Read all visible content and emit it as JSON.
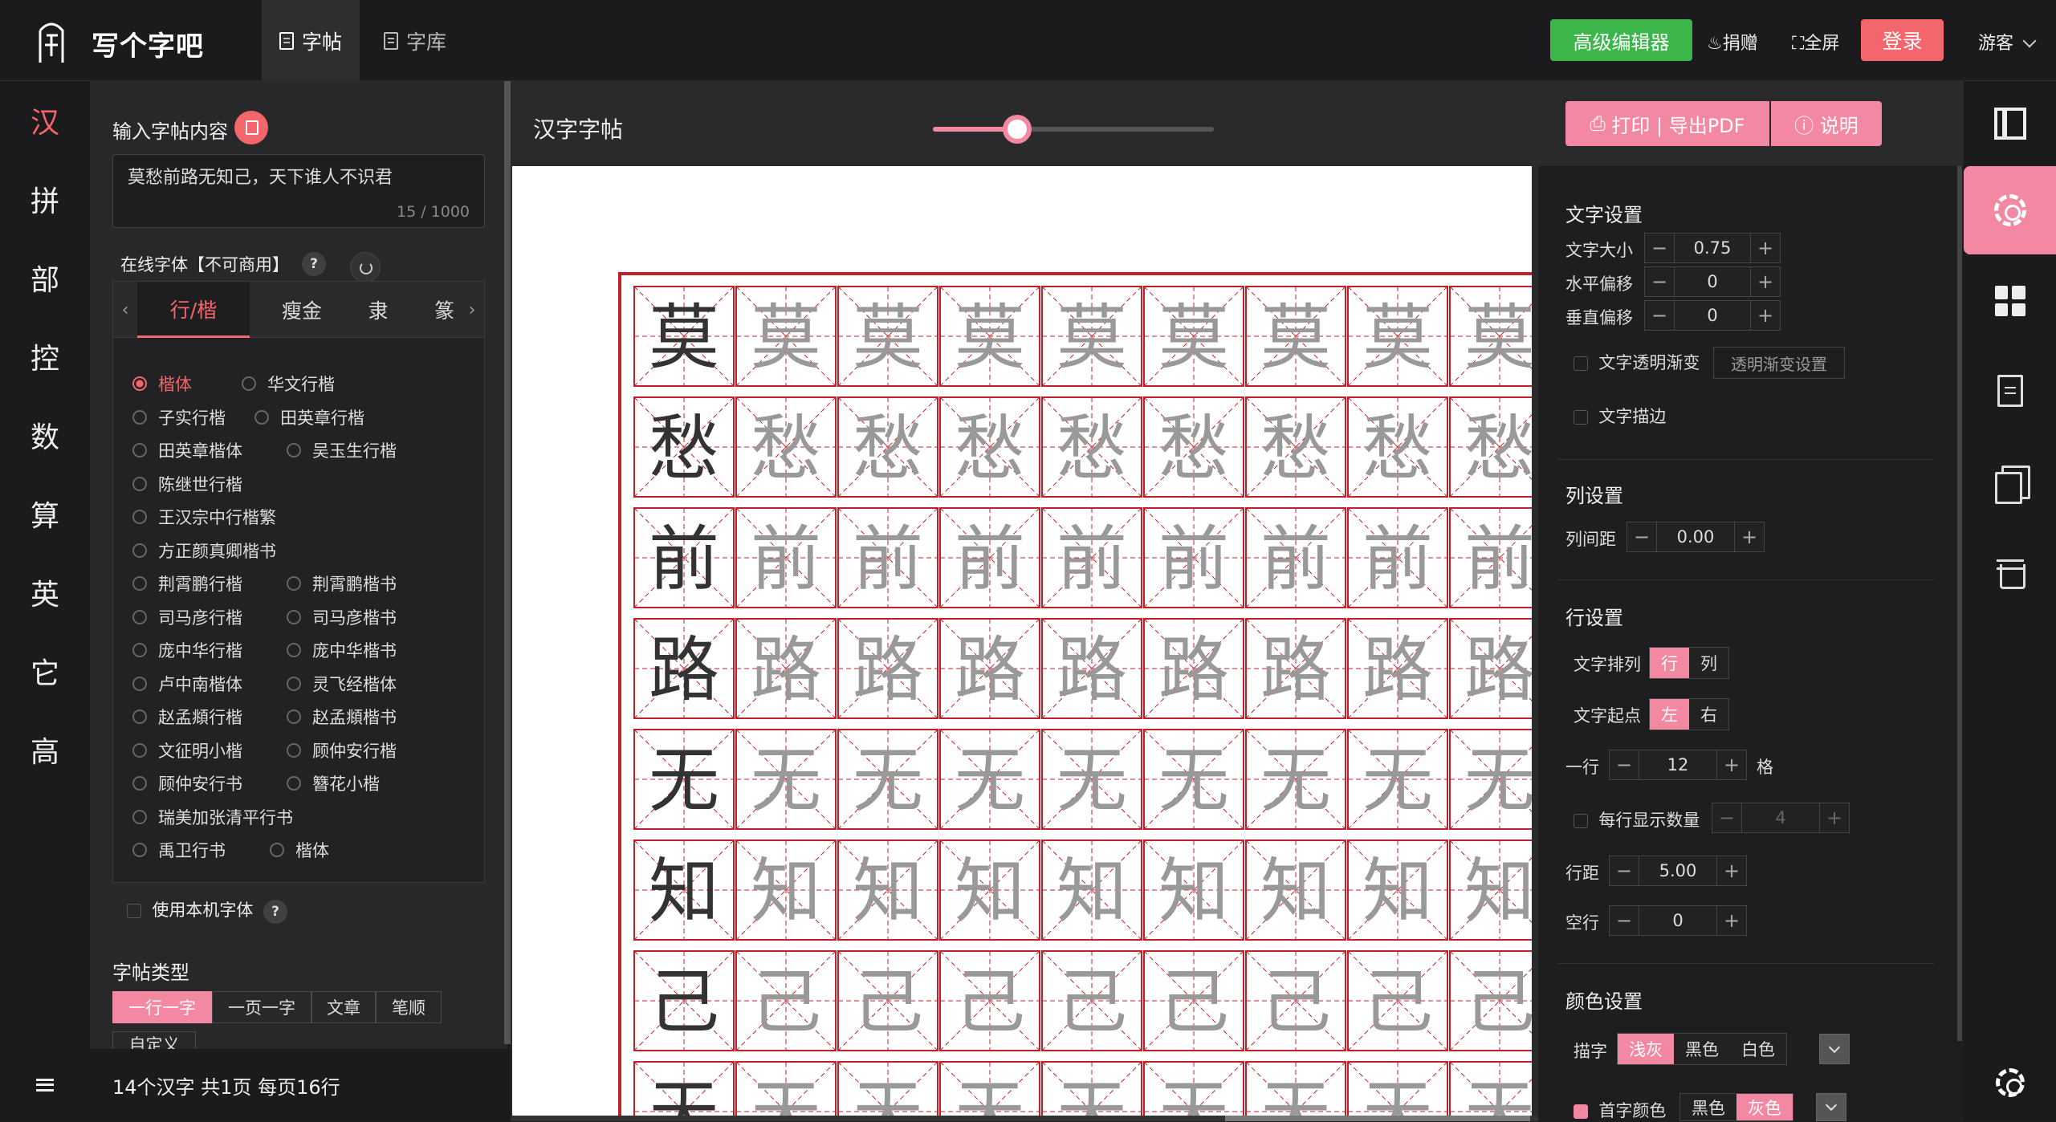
{
  "app": {
    "name": "写个字吧"
  },
  "nav": {
    "tabs": [
      {
        "label": "字帖",
        "active": true
      },
      {
        "label": "字库",
        "active": false
      }
    ]
  },
  "header": {
    "advanced_editor": "高级编辑器",
    "donate": "捐赠",
    "fullscreen": "全屏",
    "login": "登录",
    "guest": "游客"
  },
  "categories": [
    "汉",
    "拼",
    "部",
    "控",
    "数",
    "算",
    "英",
    "它",
    "高"
  ],
  "left_panel": {
    "input_label": "输入字帖内容",
    "content": "莫愁前路无知己，天下谁人不识君",
    "char_count": "15 / 1000",
    "online_font_label": "在线字体【不可商用】",
    "font_tabs": [
      "行/楷",
      "瘦金",
      "隶",
      "篆"
    ],
    "fonts": [
      {
        "name": "楷体",
        "selected": true
      },
      {
        "name": "华文行楷"
      },
      {
        "name": "子实行楷"
      },
      {
        "name": "田英章行楷"
      },
      {
        "name": "田英章楷体"
      },
      {
        "name": "吴玉生行楷"
      },
      {
        "name": "陈继世行楷"
      },
      {
        "name": "王汉宗中行楷繁"
      },
      {
        "name": "方正颜真卿楷书"
      },
      {
        "name": "荆霄鹏行楷"
      },
      {
        "name": "荆霄鹏楷书"
      },
      {
        "name": "司马彦行楷"
      },
      {
        "name": "司马彦楷书"
      },
      {
        "name": "庞中华行楷"
      },
      {
        "name": "庞中华楷书"
      },
      {
        "name": "卢中南楷体"
      },
      {
        "name": "灵飞经楷体"
      },
      {
        "name": "赵孟頫行楷"
      },
      {
        "name": "赵孟頫楷书"
      },
      {
        "name": "文征明小楷"
      },
      {
        "name": "顾仲安行楷"
      },
      {
        "name": "顾仲安行书"
      },
      {
        "name": "簪花小楷"
      },
      {
        "name": "瑞美加张清平行书"
      },
      {
        "name": "禹卫行书"
      },
      {
        "name": "楷体"
      }
    ],
    "use_local_font": "使用本机字体",
    "type_label": "字帖类型",
    "types": [
      {
        "label": "一行一字",
        "active": true
      },
      {
        "label": "一页一字"
      },
      {
        "label": "文章"
      },
      {
        "label": "笔顺"
      },
      {
        "label": "自定义"
      }
    ]
  },
  "status": "14个汉字 共1页 每页16行",
  "preview": {
    "title": "汉字字帖",
    "zoom": 0.3,
    "rows": [
      "莫",
      "愁",
      "前",
      "路",
      "无",
      "知",
      "己",
      "天"
    ]
  },
  "settings": {
    "print": "打印 | 导出PDF",
    "info": "说明",
    "text_section": "文字设置",
    "text_size_label": "文字大小",
    "text_size": "0.75",
    "h_offset_label": "水平偏移",
    "h_offset": "0",
    "v_offset_label": "垂直偏移",
    "v_offset": "0",
    "alpha_grad_label": "文字透明渐变",
    "alpha_grad_btn": "透明渐变设置",
    "stroke_label": "文字描边",
    "col_section": "列设置",
    "col_gap_label": "列间距",
    "col_gap": "0.00",
    "row_section": "行设置",
    "arrange_label": "文字排列",
    "arrange": [
      {
        "label": "行",
        "active": true
      },
      {
        "label": "列"
      }
    ],
    "start_label": "文字起点",
    "start": [
      {
        "label": "左",
        "active": true
      },
      {
        "label": "右"
      }
    ],
    "per_row_label": "一行",
    "per_row": "12",
    "per_row_unit": "格",
    "show_count_label": "每行显示数量",
    "show_count": "4",
    "row_gap_label": "行距",
    "row_gap": "5.00",
    "blank_label": "空行",
    "blank": "0",
    "color_section": "颜色设置",
    "trace_label": "描字",
    "trace": [
      {
        "label": "浅灰",
        "active": true
      },
      {
        "label": "黑色"
      },
      {
        "label": "白色"
      }
    ],
    "first_color_label": "首字颜色",
    "first_color": [
      {
        "label": "黑色"
      },
      {
        "label": "灰色",
        "active": true
      }
    ]
  },
  "colors": {
    "accent": "#f388a2",
    "green": "#3cb54a",
    "grid": "#c0202a"
  }
}
